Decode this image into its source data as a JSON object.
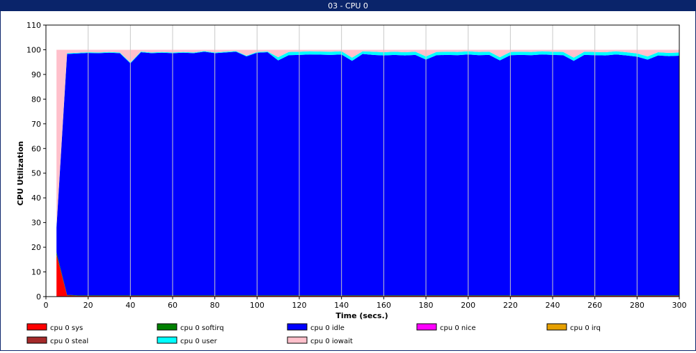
{
  "window": {
    "title": "03 - CPU 0"
  },
  "colors": {
    "titlebar": "#0a246a",
    "grid": "#c8c8c8",
    "axis": "#000000"
  },
  "chart_data": {
    "type": "area",
    "stacked": true,
    "title": "",
    "xlabel": "Time (secs.)",
    "ylabel": "CPU Utilization",
    "xlim": [
      0,
      300
    ],
    "ylim": [
      0,
      110
    ],
    "xticks": [
      0,
      20,
      40,
      60,
      80,
      100,
      120,
      140,
      160,
      180,
      200,
      220,
      240,
      260,
      280,
      300
    ],
    "yticks": [
      0,
      10,
      20,
      30,
      40,
      50,
      60,
      70,
      80,
      90,
      100,
      110
    ],
    "grid": "x-only",
    "legend_position": "bottom",
    "x": [
      5,
      10,
      15,
      20,
      25,
      30,
      35,
      40,
      45,
      50,
      55,
      60,
      65,
      70,
      75,
      80,
      85,
      90,
      95,
      100,
      105,
      110,
      115,
      120,
      125,
      130,
      135,
      140,
      145,
      150,
      155,
      160,
      165,
      170,
      175,
      180,
      185,
      190,
      195,
      200,
      205,
      210,
      215,
      220,
      225,
      230,
      235,
      240,
      245,
      250,
      255,
      260,
      265,
      270,
      275,
      280,
      285,
      290,
      295,
      300
    ],
    "series": [
      {
        "name": "cpu 0 sys",
        "color": "#ff0000",
        "values": [
          17,
          0.5,
          0.3,
          0.3,
          0.3,
          0.3,
          0.3,
          0.3,
          0.3,
          0.3,
          0.3,
          0.3,
          0.3,
          0.3,
          0.3,
          0.3,
          0.3,
          0.3,
          0.3,
          0.3,
          0.3,
          0.3,
          0.3,
          0.3,
          0.3,
          0.3,
          0.3,
          0.3,
          0.3,
          0.3,
          0.3,
          0.3,
          0.3,
          0.3,
          0.3,
          0.3,
          0.3,
          0.3,
          0.3,
          0.3,
          0.3,
          0.3,
          0.3,
          0.3,
          0.3,
          0.3,
          0.3,
          0.3,
          0.3,
          0.3,
          0.3,
          0.3,
          0.3,
          0.3,
          0.3,
          0.3,
          0.3,
          0.3,
          0.3,
          0.3
        ]
      },
      {
        "name": "cpu 0 softirq",
        "color": "#008000",
        "values": [
          1,
          0.2,
          0.2,
          0.2,
          0.2,
          0.2,
          0.2,
          0.2,
          0.2,
          0.2,
          0.2,
          0.2,
          0.2,
          0.2,
          0.2,
          0.2,
          0.2,
          0.2,
          0.2,
          0.2,
          0.2,
          0.2,
          0.2,
          0.2,
          0.2,
          0.2,
          0.2,
          0.2,
          0.2,
          0.2,
          0.2,
          0.2,
          0.2,
          0.2,
          0.2,
          0.2,
          0.2,
          0.2,
          0.2,
          0.2,
          0.2,
          0.2,
          0.2,
          0.2,
          0.2,
          0.2,
          0.2,
          0.2,
          0.2,
          0.2,
          0.2,
          0.2,
          0.2,
          0.2,
          0.2,
          0.2,
          0.2,
          0.2,
          0.2,
          0.2
        ]
      },
      {
        "name": "cpu 0 idle",
        "color": "#0000ff",
        "values": [
          10,
          97.6,
          98,
          98.2,
          98.1,
          98.3,
          98.1,
          94,
          98.5,
          98.1,
          98.3,
          98.1,
          98.3,
          98.1,
          98.7,
          98.1,
          98.4,
          98.7,
          96.8,
          98.3,
          98.5,
          95.2,
          97.3,
          97.4,
          97.6,
          97.5,
          97.4,
          97.6,
          95,
          97.8,
          97.4,
          97.2,
          97.4,
          97.2,
          97.4,
          95.5,
          97.3,
          97.4,
          97.3,
          97.6,
          97.3,
          97.4,
          95.2,
          97.3,
          97.4,
          97.3,
          97.6,
          97.4,
          97.3,
          95,
          97.4,
          97.3,
          97.2,
          97.6,
          97.2,
          96.7,
          95.5,
          97.2,
          96.9,
          97.1
        ]
      },
      {
        "name": "cpu 0 nice",
        "color": "#ff00ff",
        "values": [
          0,
          0,
          0,
          0,
          0,
          0,
          0,
          0,
          0,
          0,
          0,
          0,
          0,
          0,
          0,
          0,
          0,
          0,
          0,
          0,
          0,
          0,
          0,
          0,
          0,
          0,
          0,
          0,
          0,
          0,
          0,
          0,
          0,
          0,
          0,
          0,
          0,
          0,
          0,
          0,
          0,
          0,
          0,
          0,
          0,
          0,
          0,
          0,
          0,
          0,
          0,
          0,
          0,
          0,
          0,
          0,
          0,
          0,
          0,
          0
        ]
      },
      {
        "name": "cpu 0 irq",
        "color": "#e6a000",
        "values": [
          0,
          0,
          0,
          0,
          0,
          0,
          0,
          0,
          0,
          0,
          0,
          0,
          0,
          0,
          0,
          0,
          0,
          0,
          0,
          0,
          0,
          0,
          0,
          0,
          0,
          0,
          0,
          0,
          0,
          0,
          0,
          0,
          0,
          0,
          0,
          0,
          0,
          0,
          0,
          0,
          0,
          0,
          0,
          0,
          0,
          0,
          0,
          0,
          0,
          0,
          0,
          0,
          0,
          0,
          0,
          0,
          0,
          0,
          0,
          0
        ]
      },
      {
        "name": "cpu 0 steal",
        "color": "#a52a2a",
        "values": [
          0,
          0,
          0,
          0,
          0,
          0,
          0,
          0,
          0,
          0,
          0,
          0,
          0,
          0,
          0,
          0,
          0,
          0,
          0,
          0,
          0,
          0,
          0,
          0,
          0,
          0,
          0,
          0,
          0,
          0,
          0,
          0,
          0,
          0,
          0,
          0,
          0,
          0,
          0,
          0,
          0,
          0,
          0,
          0,
          0,
          0,
          0,
          0,
          0,
          0,
          0,
          0,
          0,
          0,
          0,
          0,
          0,
          0,
          0,
          0
        ]
      },
      {
        "name": "cpu 0 user",
        "color": "#00ffff",
        "values": [
          0.5,
          0.3,
          0.3,
          0.3,
          0.3,
          0.3,
          0.3,
          0.3,
          0.3,
          0.3,
          0.3,
          0.3,
          0.3,
          0.3,
          0.3,
          0.3,
          0.3,
          0.3,
          0.3,
          0.3,
          0.3,
          1.3,
          1.3,
          1.3,
          1.3,
          1.3,
          1.3,
          1.3,
          1.3,
          1.1,
          1.3,
          1.3,
          1.3,
          1.3,
          1.3,
          1.3,
          1.3,
          1.3,
          1.3,
          1.3,
          1.3,
          1.3,
          1.3,
          1.3,
          1.3,
          1.3,
          1.3,
          1.3,
          1.3,
          1.3,
          1.3,
          1.3,
          1.3,
          1.3,
          1.3,
          1.3,
          1.3,
          1.3,
          1.3,
          1.3
        ]
      },
      {
        "name": "cpu 0 iowait",
        "color": "#ffc0cb",
        "values": [
          71.5,
          1.4,
          1.2,
          1.0,
          1.1,
          0.9,
          1.1,
          5.2,
          0.7,
          1.1,
          0.9,
          1.1,
          0.9,
          1.1,
          0.5,
          1.1,
          0.8,
          0.5,
          2.4,
          0.9,
          0.7,
          3.0,
          0.9,
          0.8,
          0.6,
          0.7,
          0.8,
          0.6,
          3.2,
          0.6,
          0.8,
          1.0,
          0.8,
          1.0,
          0.8,
          2.7,
          0.9,
          0.8,
          0.9,
          0.6,
          0.9,
          0.8,
          3.0,
          0.9,
          0.8,
          0.9,
          0.6,
          0.8,
          0.9,
          3.2,
          0.8,
          0.9,
          1.0,
          0.6,
          1.0,
          1.5,
          2.7,
          1.0,
          1.3,
          1.1
        ]
      }
    ]
  }
}
